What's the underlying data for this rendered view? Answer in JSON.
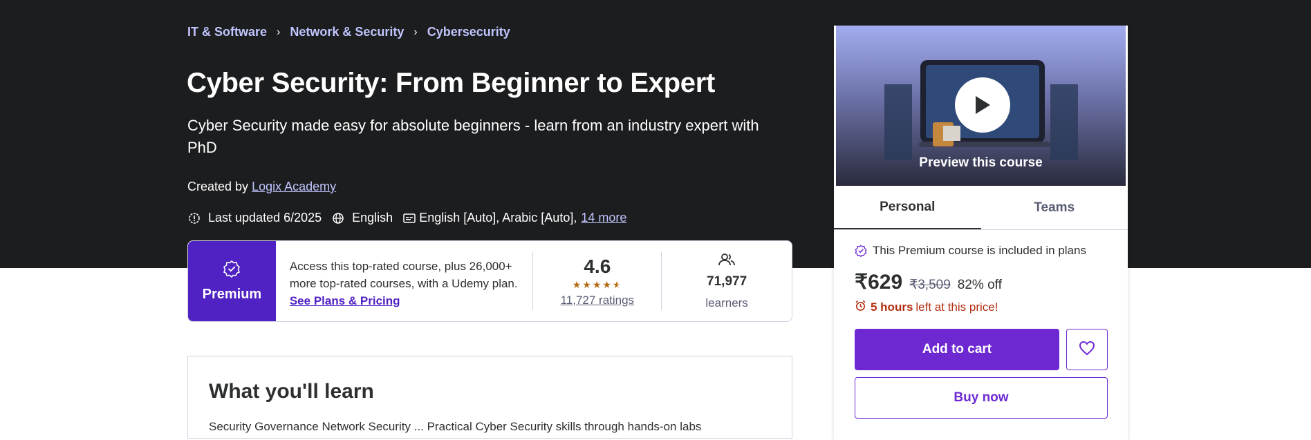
{
  "breadcrumb": {
    "items": [
      "IT & Software",
      "Network & Security",
      "Cybersecurity"
    ],
    "separator": "›"
  },
  "course": {
    "title": "Cyber Security: From Beginner to Expert",
    "subtitle": "Cyber Security made easy for absolute beginners - learn from an industry expert with PhD",
    "created_by_label": "Created by",
    "author": "Logix Academy",
    "last_updated": "Last updated 6/2025",
    "language": "English",
    "captions": "English [Auto], Arabic [Auto],",
    "captions_more": "14 more"
  },
  "premium": {
    "label": "Premium",
    "description": "Access this top-rated course, plus 26,000+ more top-rated courses, with a Udemy plan.",
    "link": "See Plans & Pricing",
    "rating": "4.6",
    "rating_stars": 4.5,
    "ratings_count": "11,727 ratings",
    "learners_count": "71,977",
    "learners_label": "learners"
  },
  "learn": {
    "title": "What you'll learn",
    "peek": "Security Governance    Network Security ...        Practical Cyber Security skills through hands-on labs"
  },
  "sidebar": {
    "preview_label": "Preview this course",
    "tabs": [
      "Personal",
      "Teams"
    ],
    "active_tab": "Personal",
    "included_text": "This Premium course is included in plans",
    "price": "₹629",
    "original_price": "₹3,509",
    "discount": "82% off",
    "timer_bold": "5 hours",
    "timer_text": "left at this price!",
    "add_to_cart": "Add to cart",
    "buy_now": "Buy now"
  },
  "colors": {
    "hero_bg": "#1c1d1f",
    "accent_purple": "#6d28d2",
    "premium_purple": "#5022c3",
    "link_lavender": "#c0c4fc",
    "star_orange": "#b4690e",
    "timer_red": "#b32d0f"
  }
}
